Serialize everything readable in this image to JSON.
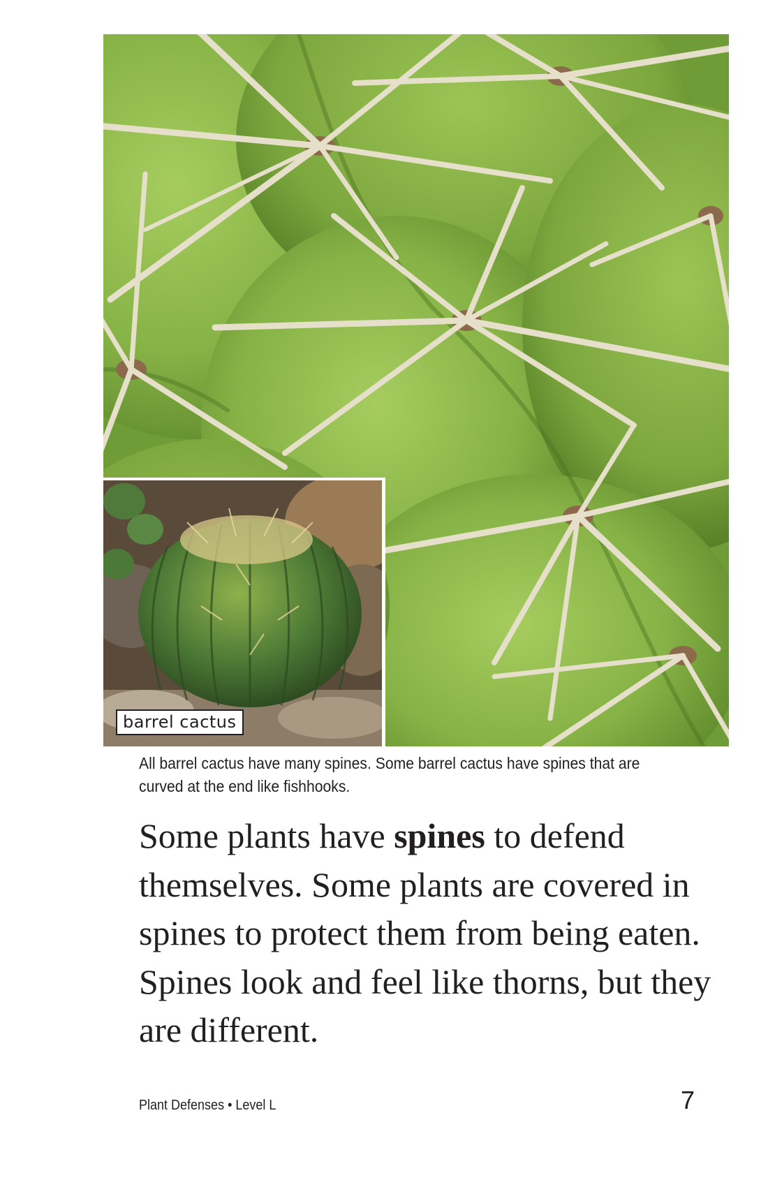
{
  "photo": {
    "main_subject": "barrel cactus close-up with spines",
    "colors": {
      "cactus_green": "#7aa83c",
      "spine_cream": "#e8e2cf",
      "areole_brown": "#8a6a4a"
    }
  },
  "inset": {
    "label": "barrel cactus"
  },
  "caption": "All barrel cactus have many spines. Some barrel cactus have spines that are curved at the end like fishhooks.",
  "body": {
    "before": "Some plants have ",
    "bold_word": "spines",
    "after": " to defend themselves. Some plants are covered in spines to protect them from being eaten. Spines look and feel like thorns, but they are different."
  },
  "footer": {
    "title": "Plant Defenses • Level L",
    "page_number": "7"
  }
}
